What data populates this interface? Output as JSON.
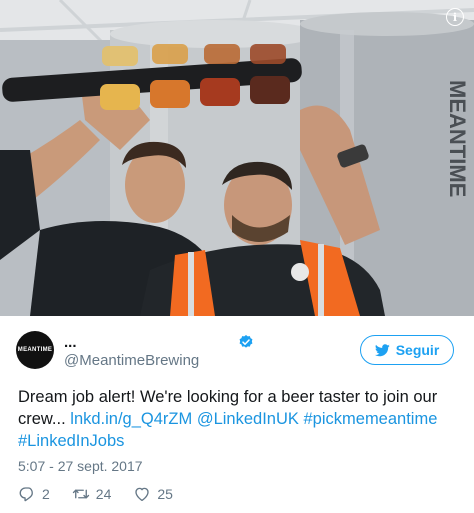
{
  "tweet": {
    "avatar_text": "MEANTIME",
    "display_name": "...",
    "handle": "@MeantimeBrewing",
    "follow_label": "Seguir",
    "text_intro": "Dream job alert! We're looking for a beer taster to join our crew...",
    "link": "lnkd.in/g_Q4rZM",
    "mention": "@LinkedInUK",
    "hashtag_1": "#pickmemeantime",
    "hashtag_2": "#LinkedInJobs",
    "timestamp": "5:07 - 27 sept. 2017",
    "reply_count": "2",
    "retweet_count": "24",
    "like_count": "25"
  },
  "photo": {
    "tank_text": "MEANTIME",
    "polo_logo_text": "MEANTIME"
  },
  "colors": {
    "accent": "#1da1f2",
    "link": "#1b95e0",
    "muted": "#657786",
    "text": "#14171a"
  },
  "icons": [
    "info-icon",
    "verified-icon",
    "twitter-bird-icon",
    "reply-icon",
    "retweet-icon",
    "like-icon"
  ]
}
